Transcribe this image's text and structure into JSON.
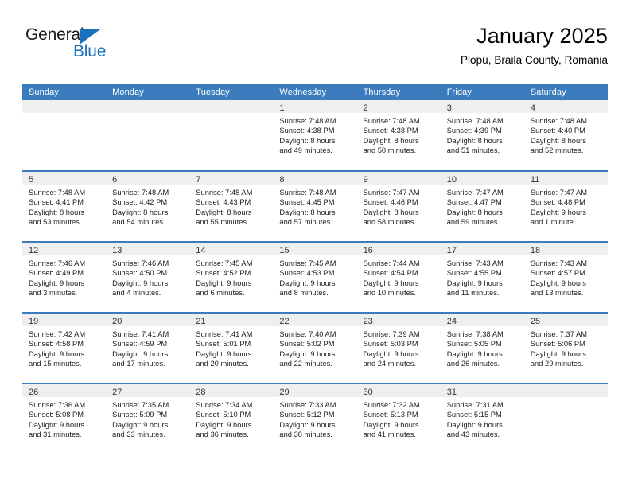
{
  "brand": {
    "name_part1": "General",
    "name_part2": "Blue",
    "triangle_color": "#1a72bb"
  },
  "header": {
    "title": "January 2025",
    "subtitle": "Plopu, Braila County, Romania"
  },
  "theme": {
    "header_blue": "#3a7cbe",
    "daynum_strip": "#efefef",
    "text": "#1c1c1c"
  },
  "weekday_headers": [
    "Sunday",
    "Monday",
    "Tuesday",
    "Wednesday",
    "Thursday",
    "Friday",
    "Saturday"
  ],
  "weeks": [
    [
      {
        "day": "",
        "sunrise": "",
        "sunset": "",
        "daylight_1": "",
        "daylight_2": ""
      },
      {
        "day": "",
        "sunrise": "",
        "sunset": "",
        "daylight_1": "",
        "daylight_2": ""
      },
      {
        "day": "",
        "sunrise": "",
        "sunset": "",
        "daylight_1": "",
        "daylight_2": ""
      },
      {
        "day": "1",
        "sunrise": "Sunrise: 7:48 AM",
        "sunset": "Sunset: 4:38 PM",
        "daylight_1": "Daylight: 8 hours",
        "daylight_2": "and 49 minutes."
      },
      {
        "day": "2",
        "sunrise": "Sunrise: 7:48 AM",
        "sunset": "Sunset: 4:38 PM",
        "daylight_1": "Daylight: 8 hours",
        "daylight_2": "and 50 minutes."
      },
      {
        "day": "3",
        "sunrise": "Sunrise: 7:48 AM",
        "sunset": "Sunset: 4:39 PM",
        "daylight_1": "Daylight: 8 hours",
        "daylight_2": "and 51 minutes."
      },
      {
        "day": "4",
        "sunrise": "Sunrise: 7:48 AM",
        "sunset": "Sunset: 4:40 PM",
        "daylight_1": "Daylight: 8 hours",
        "daylight_2": "and 52 minutes."
      }
    ],
    [
      {
        "day": "5",
        "sunrise": "Sunrise: 7:48 AM",
        "sunset": "Sunset: 4:41 PM",
        "daylight_1": "Daylight: 8 hours",
        "daylight_2": "and 53 minutes."
      },
      {
        "day": "6",
        "sunrise": "Sunrise: 7:48 AM",
        "sunset": "Sunset: 4:42 PM",
        "daylight_1": "Daylight: 8 hours",
        "daylight_2": "and 54 minutes."
      },
      {
        "day": "7",
        "sunrise": "Sunrise: 7:48 AM",
        "sunset": "Sunset: 4:43 PM",
        "daylight_1": "Daylight: 8 hours",
        "daylight_2": "and 55 minutes."
      },
      {
        "day": "8",
        "sunrise": "Sunrise: 7:48 AM",
        "sunset": "Sunset: 4:45 PM",
        "daylight_1": "Daylight: 8 hours",
        "daylight_2": "and 57 minutes."
      },
      {
        "day": "9",
        "sunrise": "Sunrise: 7:47 AM",
        "sunset": "Sunset: 4:46 PM",
        "daylight_1": "Daylight: 8 hours",
        "daylight_2": "and 58 minutes."
      },
      {
        "day": "10",
        "sunrise": "Sunrise: 7:47 AM",
        "sunset": "Sunset: 4:47 PM",
        "daylight_1": "Daylight: 8 hours",
        "daylight_2": "and 59 minutes."
      },
      {
        "day": "11",
        "sunrise": "Sunrise: 7:47 AM",
        "sunset": "Sunset: 4:48 PM",
        "daylight_1": "Daylight: 9 hours",
        "daylight_2": "and 1 minute."
      }
    ],
    [
      {
        "day": "12",
        "sunrise": "Sunrise: 7:46 AM",
        "sunset": "Sunset: 4:49 PM",
        "daylight_1": "Daylight: 9 hours",
        "daylight_2": "and 3 minutes."
      },
      {
        "day": "13",
        "sunrise": "Sunrise: 7:46 AM",
        "sunset": "Sunset: 4:50 PM",
        "daylight_1": "Daylight: 9 hours",
        "daylight_2": "and 4 minutes."
      },
      {
        "day": "14",
        "sunrise": "Sunrise: 7:45 AM",
        "sunset": "Sunset: 4:52 PM",
        "daylight_1": "Daylight: 9 hours",
        "daylight_2": "and 6 minutes."
      },
      {
        "day": "15",
        "sunrise": "Sunrise: 7:45 AM",
        "sunset": "Sunset: 4:53 PM",
        "daylight_1": "Daylight: 9 hours",
        "daylight_2": "and 8 minutes."
      },
      {
        "day": "16",
        "sunrise": "Sunrise: 7:44 AM",
        "sunset": "Sunset: 4:54 PM",
        "daylight_1": "Daylight: 9 hours",
        "daylight_2": "and 10 minutes."
      },
      {
        "day": "17",
        "sunrise": "Sunrise: 7:43 AM",
        "sunset": "Sunset: 4:55 PM",
        "daylight_1": "Daylight: 9 hours",
        "daylight_2": "and 11 minutes."
      },
      {
        "day": "18",
        "sunrise": "Sunrise: 7:43 AM",
        "sunset": "Sunset: 4:57 PM",
        "daylight_1": "Daylight: 9 hours",
        "daylight_2": "and 13 minutes."
      }
    ],
    [
      {
        "day": "19",
        "sunrise": "Sunrise: 7:42 AM",
        "sunset": "Sunset: 4:58 PM",
        "daylight_1": "Daylight: 9 hours",
        "daylight_2": "and 15 minutes."
      },
      {
        "day": "20",
        "sunrise": "Sunrise: 7:41 AM",
        "sunset": "Sunset: 4:59 PM",
        "daylight_1": "Daylight: 9 hours",
        "daylight_2": "and 17 minutes."
      },
      {
        "day": "21",
        "sunrise": "Sunrise: 7:41 AM",
        "sunset": "Sunset: 5:01 PM",
        "daylight_1": "Daylight: 9 hours",
        "daylight_2": "and 20 minutes."
      },
      {
        "day": "22",
        "sunrise": "Sunrise: 7:40 AM",
        "sunset": "Sunset: 5:02 PM",
        "daylight_1": "Daylight: 9 hours",
        "daylight_2": "and 22 minutes."
      },
      {
        "day": "23",
        "sunrise": "Sunrise: 7:39 AM",
        "sunset": "Sunset: 5:03 PM",
        "daylight_1": "Daylight: 9 hours",
        "daylight_2": "and 24 minutes."
      },
      {
        "day": "24",
        "sunrise": "Sunrise: 7:38 AM",
        "sunset": "Sunset: 5:05 PM",
        "daylight_1": "Daylight: 9 hours",
        "daylight_2": "and 26 minutes."
      },
      {
        "day": "25",
        "sunrise": "Sunrise: 7:37 AM",
        "sunset": "Sunset: 5:06 PM",
        "daylight_1": "Daylight: 9 hours",
        "daylight_2": "and 29 minutes."
      }
    ],
    [
      {
        "day": "26",
        "sunrise": "Sunrise: 7:36 AM",
        "sunset": "Sunset: 5:08 PM",
        "daylight_1": "Daylight: 9 hours",
        "daylight_2": "and 31 minutes."
      },
      {
        "day": "27",
        "sunrise": "Sunrise: 7:35 AM",
        "sunset": "Sunset: 5:09 PM",
        "daylight_1": "Daylight: 9 hours",
        "daylight_2": "and 33 minutes."
      },
      {
        "day": "28",
        "sunrise": "Sunrise: 7:34 AM",
        "sunset": "Sunset: 5:10 PM",
        "daylight_1": "Daylight: 9 hours",
        "daylight_2": "and 36 minutes."
      },
      {
        "day": "29",
        "sunrise": "Sunrise: 7:33 AM",
        "sunset": "Sunset: 5:12 PM",
        "daylight_1": "Daylight: 9 hours",
        "daylight_2": "and 38 minutes."
      },
      {
        "day": "30",
        "sunrise": "Sunrise: 7:32 AM",
        "sunset": "Sunset: 5:13 PM",
        "daylight_1": "Daylight: 9 hours",
        "daylight_2": "and 41 minutes."
      },
      {
        "day": "31",
        "sunrise": "Sunrise: 7:31 AM",
        "sunset": "Sunset: 5:15 PM",
        "daylight_1": "Daylight: 9 hours",
        "daylight_2": "and 43 minutes."
      },
      {
        "day": "",
        "sunrise": "",
        "sunset": "",
        "daylight_1": "",
        "daylight_2": ""
      }
    ]
  ]
}
